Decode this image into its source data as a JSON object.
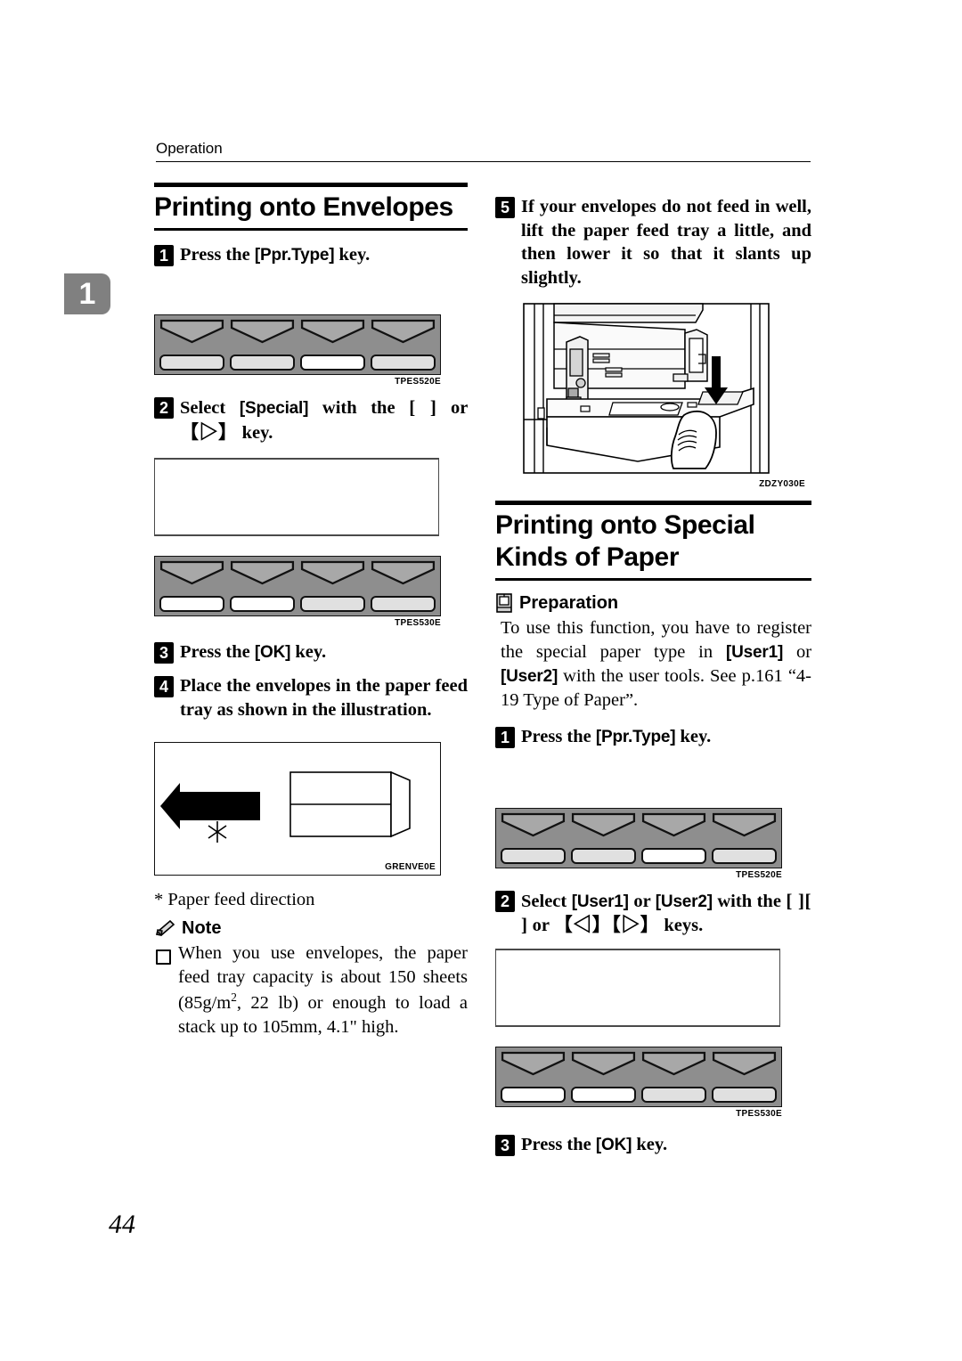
{
  "page": {
    "running_header": "Operation",
    "chapter_tab": "1",
    "page_number": "44"
  },
  "left_column": {
    "heading": "Printing onto Envelopes",
    "steps": [
      {
        "num": "1",
        "text": "Press the [Ppr.Type] key."
      },
      {
        "num": "2",
        "text": "Select [Special] with the [   ] or [▷] key."
      },
      {
        "num": "3",
        "text": "Press the [OK] key."
      },
      {
        "num": "4",
        "text": "Place the envelopes in the paper feed tray as shown in the illustration."
      }
    ],
    "step1_label": "Press the",
    "step1_key": "[Ppr.Type]",
    "step1_tail": "key.",
    "step2_lead": "Select",
    "step2_key": "[Special]",
    "step2_mid": "with the",
    "step2_key_blank": "[   ]",
    "step2_or": "or",
    "step2_key_right": "【▷】",
    "step2_tail": "key.",
    "step3_label": "Press the",
    "step3_key": "[OK]",
    "step3_tail": "key.",
    "step4_text": "Place the envelopes in the paper feed tray as shown in the illustration.",
    "figures": {
      "keypad1_caption": "TPES520E",
      "keypad2_caption": "TPES530E",
      "envelope_caption": "GRENVE0E"
    },
    "footnote": "* Paper feed direction",
    "note": {
      "icon": "pencil-icon",
      "title": "Note",
      "bullets": [
        "When you use envelopes, the paper feed tray capacity is about 150 sheets (85g/m2, 22 lb) or enough to load a stack up to 105mm, 4.1\" high."
      ],
      "bullet_part1": "When you use envelopes, the paper feed tray capacity is about 150 sheets (85g/m",
      "bullet_sup": "2",
      "bullet_part2": ", 22 lb) or enough to load a stack up to 105mm, 4.1\" high."
    }
  },
  "right_column": {
    "step5": {
      "num": "5",
      "text": "If your envelopes do not feed in well, lift the paper feed tray a little, and then lower it so that it slants up slightly."
    },
    "printer_figure_caption": "ZDZY030E",
    "heading": "Printing onto Special Kinds of Paper",
    "preparation": {
      "icon": "book-icon",
      "title": "Preparation",
      "body_part1": "To use this function, you have to register the special paper type in",
      "key1": "[User1]",
      "body_or": "or",
      "key2": "[User2]",
      "body_part2": "with the user tools. See p.161 “4-19 Type of Paper”."
    },
    "steps": [
      {
        "num": "1",
        "text": "Press the [Ppr.Type] key."
      },
      {
        "num": "2",
        "text": "Select [User1] or [User2] with the [   ][   ] or [◁][▷] keys."
      },
      {
        "num": "3",
        "text": "Press the [OK] key."
      }
    ],
    "step1_label": "Press the",
    "step1_key": "[Ppr.Type]",
    "step1_tail": "key.",
    "step2_lead": "Select",
    "step2_key1": "[User1]",
    "step2_or": "or",
    "step2_key2": "[User2]",
    "step2_mid": "with the",
    "step2_blank1": "[   ]",
    "step2_blank2": "[   ]",
    "step2_or2": "or",
    "step2_left_arrow": "【◁】",
    "step2_right_arrow": "【▷】",
    "step2_tail": "keys.",
    "step3_label": "Press the",
    "step3_key": "[OK]",
    "step3_tail": "key.",
    "figures": {
      "keypad1_caption": "TPES520E",
      "keypad2_caption": "TPES530E"
    }
  },
  "keypads": {
    "tpes520e": {
      "caption": "TPES520E",
      "keys": [
        "lt",
        "lt",
        "wh",
        "lt"
      ]
    },
    "tpes530e": {
      "caption": "TPES530E",
      "keys": [
        "wh",
        "wh",
        "lt",
        "lt"
      ]
    }
  },
  "colors": {
    "panel_gray": "#8e8e8e",
    "key_light": "#e0e0e0",
    "key_white": "#ffffff",
    "tab_gray": "#808080",
    "ink": "#000000"
  }
}
